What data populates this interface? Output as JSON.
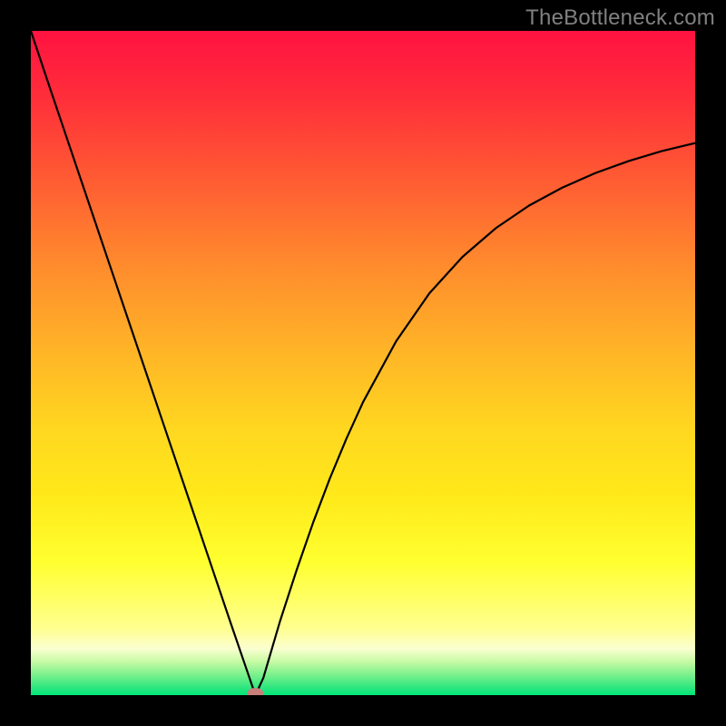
{
  "watermark": "TheBottleneck.com",
  "chart_data": {
    "type": "line",
    "title": "",
    "xlabel": "",
    "ylabel": "",
    "xlim": [
      0,
      100
    ],
    "ylim": [
      0,
      100
    ],
    "series": [
      {
        "name": "bottleneck-curve",
        "x": [
          0,
          2.5,
          5,
          7.5,
          10,
          12.5,
          15,
          17.5,
          20,
          22.5,
          25,
          27.5,
          30,
          32.5,
          33.8,
          35,
          37.5,
          40,
          42.5,
          45,
          47.5,
          50,
          55,
          60,
          65,
          70,
          75,
          80,
          85,
          90,
          95,
          100
        ],
        "y": [
          100,
          92.5,
          85.1,
          77.7,
          70.3,
          62.9,
          55.5,
          48.1,
          40.7,
          33.3,
          25.9,
          18.5,
          11.1,
          3.8,
          0,
          2.6,
          11.1,
          18.8,
          26.0,
          32.6,
          38.6,
          44.1,
          53.3,
          60.5,
          66.0,
          70.3,
          73.7,
          76.4,
          78.6,
          80.4,
          81.9,
          83.1
        ]
      }
    ],
    "marker": {
      "x": 33.8,
      "y": 0.3,
      "rx": 1.2,
      "ry": 0.8
    },
    "annotations": []
  },
  "colors": {
    "curve": "#000000",
    "marker": "#c97f7c",
    "frame": "#000000"
  }
}
